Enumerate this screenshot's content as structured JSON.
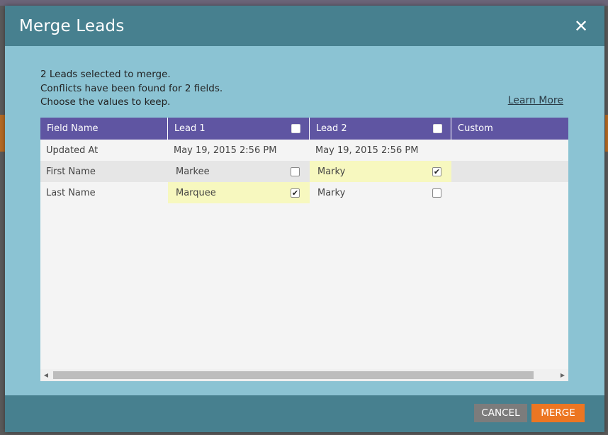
{
  "dialog": {
    "title": "Merge Leads",
    "close_icon": "close-icon"
  },
  "intro": {
    "line1": "2 Leads selected to merge.",
    "line2": "Conflicts have been found for 2 fields.",
    "line3": "Choose the values to keep."
  },
  "learn_more": "Learn More",
  "grid": {
    "headers": {
      "field_name": "Field Name",
      "lead1": "Lead 1",
      "lead2": "Lead 2",
      "custom": "Custom"
    },
    "rows": [
      {
        "field": "Updated At",
        "lead1": "May 19, 2015 2:56 PM",
        "lead2": "May 19, 2015 2:56 PM",
        "custom": ""
      },
      {
        "field": "First Name",
        "lead1": "Markee",
        "lead2": "Marky",
        "custom": "",
        "lead1_checked": false,
        "lead2_checked": true
      },
      {
        "field": "Last Name",
        "lead1": "Marquee",
        "lead2": "Marky",
        "custom": "",
        "lead1_checked": true,
        "lead2_checked": false
      }
    ]
  },
  "footer": {
    "cancel_label": "CANCEL",
    "merge_label": "MERGE"
  },
  "colors": {
    "header_bg": "#47808f",
    "dialog_bg": "#8bc3d3",
    "grid_header_bg": "#5f55a2",
    "highlight": "#f7f8bf",
    "merge_button": "#ec7622",
    "cancel_button": "#7c7c7c"
  }
}
